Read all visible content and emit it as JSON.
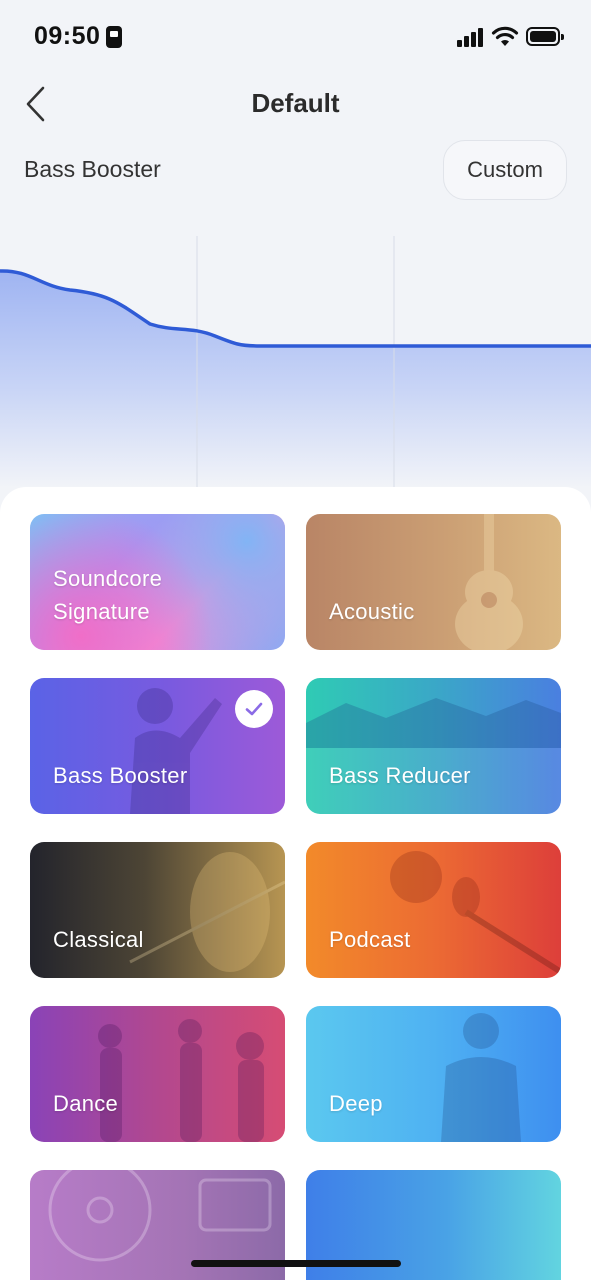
{
  "status_bar": {
    "time": "09:50"
  },
  "nav": {
    "title": "Default"
  },
  "preset": {
    "current_name": "Bass Booster",
    "custom_label": "Custom"
  },
  "colors": {
    "accent": "#3a63d8",
    "selected_check": "#8b6be6"
  },
  "presets": [
    {
      "label": "Soundcore\nSignature",
      "selected": false
    },
    {
      "label": "Acoustic",
      "selected": false
    },
    {
      "label": "Bass Booster",
      "selected": true
    },
    {
      "label": "Bass Reducer",
      "selected": false
    },
    {
      "label": "Classical",
      "selected": false
    },
    {
      "label": "Podcast",
      "selected": false
    },
    {
      "label": "Dance",
      "selected": false
    },
    {
      "label": "Deep",
      "selected": false
    },
    {
      "label": "",
      "selected": false
    },
    {
      "label": "",
      "selected": false
    }
  ]
}
